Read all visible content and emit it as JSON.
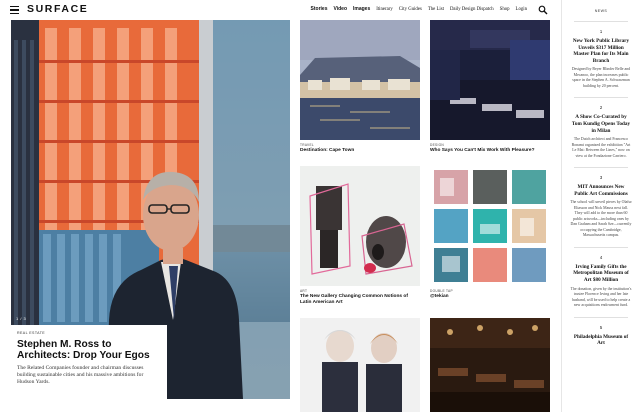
{
  "header": {
    "logo": "SURFACE",
    "nav": [
      "Stories",
      "Video",
      "Images",
      "Itinerary",
      "City Guides",
      "The List",
      "Daily Design Dispatch",
      "Shop",
      "Login"
    ],
    "menu_icon": "hamburger-icon",
    "search_icon": "search-icon"
  },
  "hero": {
    "category": "REAL ESTATE",
    "title": "Stephen M. Ross to Architects: Drop Your Egos",
    "dek": "The Related Companies founder and chairman discusses building sustainable cities and his massive ambitions for Hudson Yards.",
    "pager": "1 / 3"
  },
  "cards": [
    {
      "category": "TRAVEL",
      "title": "Destination: Cape Town"
    },
    {
      "category": "DESIGN",
      "title": "Who Says You Can't Mix Work With Pleasure?"
    },
    {
      "category": "ART",
      "title": "The New Gallery Changing Common Notions of Latin American Art"
    },
    {
      "category": "DOUBLE TAP",
      "title": "@tekian"
    },
    {
      "category": "",
      "title": ""
    },
    {
      "category": "",
      "title": ""
    }
  ],
  "sidebar": {
    "heading": "NEWS",
    "items": [
      {
        "num": "1",
        "title": "New York Public Library Unveils $317 Million Master Plan for Its Main Branch",
        "dek": "Designed by Beyer Blinder Belle and Mecanoo, the plan increases public space in the Stephen A. Schwarzman building by 20 percent."
      },
      {
        "num": "2",
        "title": "A Show Co-Curated by Tom Kundig Opens Today in Milan",
        "dek": "The Dutch architect and Francesco Bonami organized the exhibition \"Art Le Mat: Between the Lines,\" now on view at the Fondazione Carriero."
      },
      {
        "num": "3",
        "title": "MIT Announces New Public Art Commissions",
        "dek": "The school will unveil pieces by Olafur Eliasson and Nick Mauss next fall. They will add to the more than 60 public artworks—including ones by Dan Graham and Sarah Sze—currently occupying the Cambridge, Massachusetts campus."
      },
      {
        "num": "4",
        "title": "Irving Family Gifts the Metropolitan Museum of Art $80 Million",
        "dek": "The donation, given by the institution's trustee Florence Irving and her late husband, will be used to help create a new acquisitions endowment fund."
      },
      {
        "num": "5",
        "title": "Philadelphia Museum of Art",
        "dek": ""
      }
    ]
  },
  "colors": {
    "accent": "#111111",
    "sky": "#6fa6c8",
    "tower_orange": "#e86a3a"
  }
}
